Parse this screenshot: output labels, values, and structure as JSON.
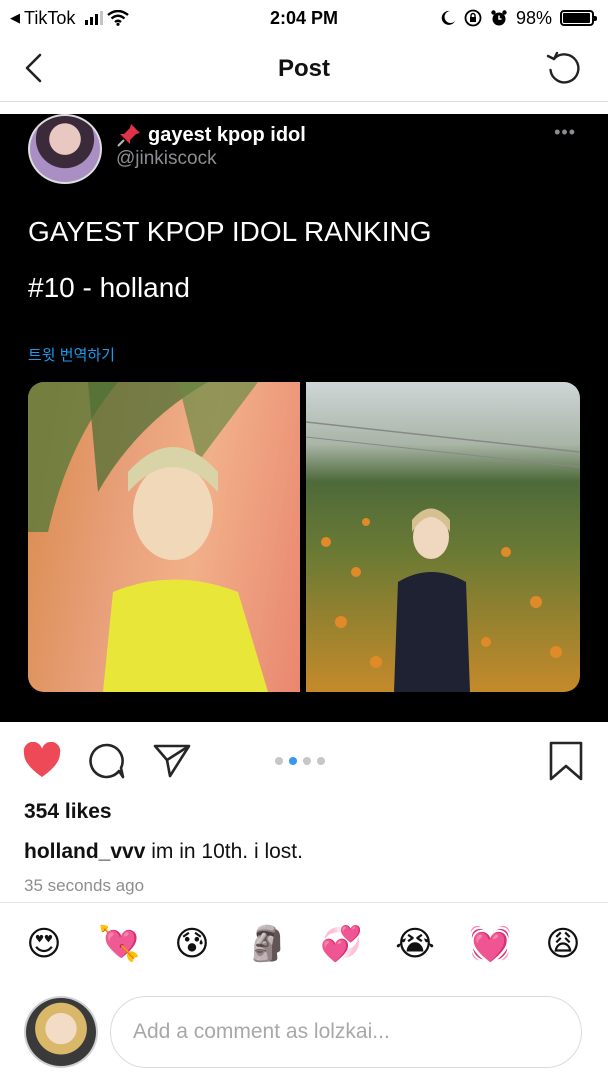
{
  "status_bar": {
    "back_app": "TikTok",
    "time": "2:04 PM",
    "battery": "98%",
    "battery_level": 0.98,
    "icons": [
      "back-triangle-icon",
      "signal-icon",
      "wifi-icon",
      "moon-icon",
      "orientation-lock-icon",
      "alarm-icon",
      "battery-icon"
    ]
  },
  "nav": {
    "title": "Post",
    "icons": [
      "back-chevron-icon",
      "refresh-icon"
    ]
  },
  "tweet": {
    "display_name": "gayest kpop idol",
    "handle": "@jinkiscock",
    "line1": "GAYEST KPOP IDOL RANKING",
    "line2": "#10 - holland",
    "translate_link": "트윗 번역하기",
    "icons": [
      "pin-icon",
      "more-dots-icon"
    ],
    "accent": "#1d9bf0"
  },
  "carousel": {
    "count": 4,
    "active_index": 1
  },
  "actions": {
    "icons": [
      "heart-icon",
      "comment-icon",
      "share-icon",
      "bookmark-icon"
    ],
    "liked": true,
    "heart_color": "#ed4956"
  },
  "likes": "354 likes",
  "caption": {
    "username": "holland_vvv",
    "text": "im in 10th. i lost."
  },
  "timestamp": "35 seconds ago",
  "emoji_reactions": [
    "😍",
    "💘",
    "😰",
    "🗿",
    "💞",
    "😭",
    "💓",
    "😩"
  ],
  "comment": {
    "placeholder": "Add a comment as lolzkai..."
  }
}
